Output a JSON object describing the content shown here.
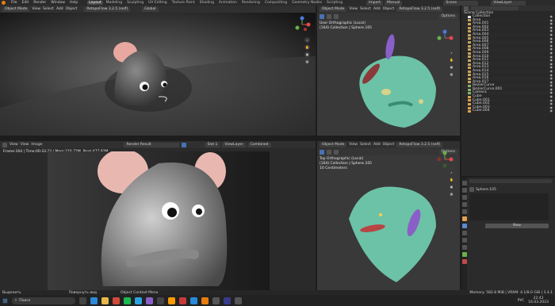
{
  "menu": [
    "File",
    "Edit",
    "Render",
    "Window",
    "Help"
  ],
  "workspaces": [
    "Layout",
    "Modeling",
    "Sculpting",
    "UV Editing",
    "Texture Paint",
    "Shading",
    "Animation",
    "Rendering",
    "Compositing",
    "Geometry Nodes",
    "Scripting"
  ],
  "active_workspace": "Layout",
  "top_right": {
    "import": "Import",
    "manual": "Manual",
    "scene": "Scene",
    "view_layer": "ViewLayer"
  },
  "viewport_tl": {
    "mode": "Object Mode",
    "menus": [
      "View",
      "Select",
      "Add",
      "Object"
    ],
    "addon": "RetopoFlow 3.2.5 (self)",
    "transform": "Global"
  },
  "viewport_tr": {
    "mode": "Object Mode",
    "menus": [
      "View",
      "Select",
      "Add",
      "Object"
    ],
    "addon": "RetopoFlow 3.2.5 (self)",
    "options": "Options",
    "info1": "User Orthographic (Local)",
    "info2": "(164) Collection | Sphere.105"
  },
  "viewport_br": {
    "mode": "Object Mode",
    "menus": [
      "View",
      "Select",
      "Add",
      "Object"
    ],
    "addon": "RetopoFlow 3.2.5 (self)",
    "options": "Options",
    "info1": "Top Orthographic (Local)",
    "info2": "(164) Collection | Sphere.105",
    "info3": "10 Centimeters"
  },
  "render_view": {
    "menus": [
      "View",
      "View",
      "Image"
    ],
    "image": "Render Result",
    "slot": "Slot 1",
    "layer": "ViewLayer",
    "pass": "Combined",
    "status": "Frame:164 | Time:00:33.23 | Mem:210.72M, Peak:477.93M"
  },
  "outliner": {
    "title": "Scene Collection",
    "rows": [
      "Collection",
      "Area",
      "Area.001",
      "Area.002",
      "Area.003",
      "Area.004",
      "Area.005",
      "Area.006",
      "Area.007",
      "Area.008",
      "Area.009",
      "Area.010",
      "Area.011",
      "Area.012",
      "Area.013",
      "Area.014",
      "Area.015",
      "Area.016",
      "Area.017",
      "BezierCurve",
      "BezierCurve.001",
      "Camera",
      "Cube",
      "Cube.001",
      "Cube.002",
      "Cube.003",
      "Cube.004"
    ]
  },
  "properties": {
    "object_name": "Sphere.105",
    "add_button": "New"
  },
  "statusbar": {
    "left": "Выделить",
    "mid1": "Повернуть вид",
    "mid2": "Object Context Menu",
    "right": "Memory: 582.8 MiB | VRAM: 4.1/8.0 GiB | 3.4.1"
  },
  "taskbar": {
    "search": "Поиск",
    "lang": "РУС",
    "time": "22:42",
    "date": "16.03.2023"
  },
  "colors": {
    "accent": "#4772b3",
    "mouse_body": "#6cc2a6",
    "ear": "#8a5fc7",
    "pink_ear": "#e8a8a0"
  }
}
